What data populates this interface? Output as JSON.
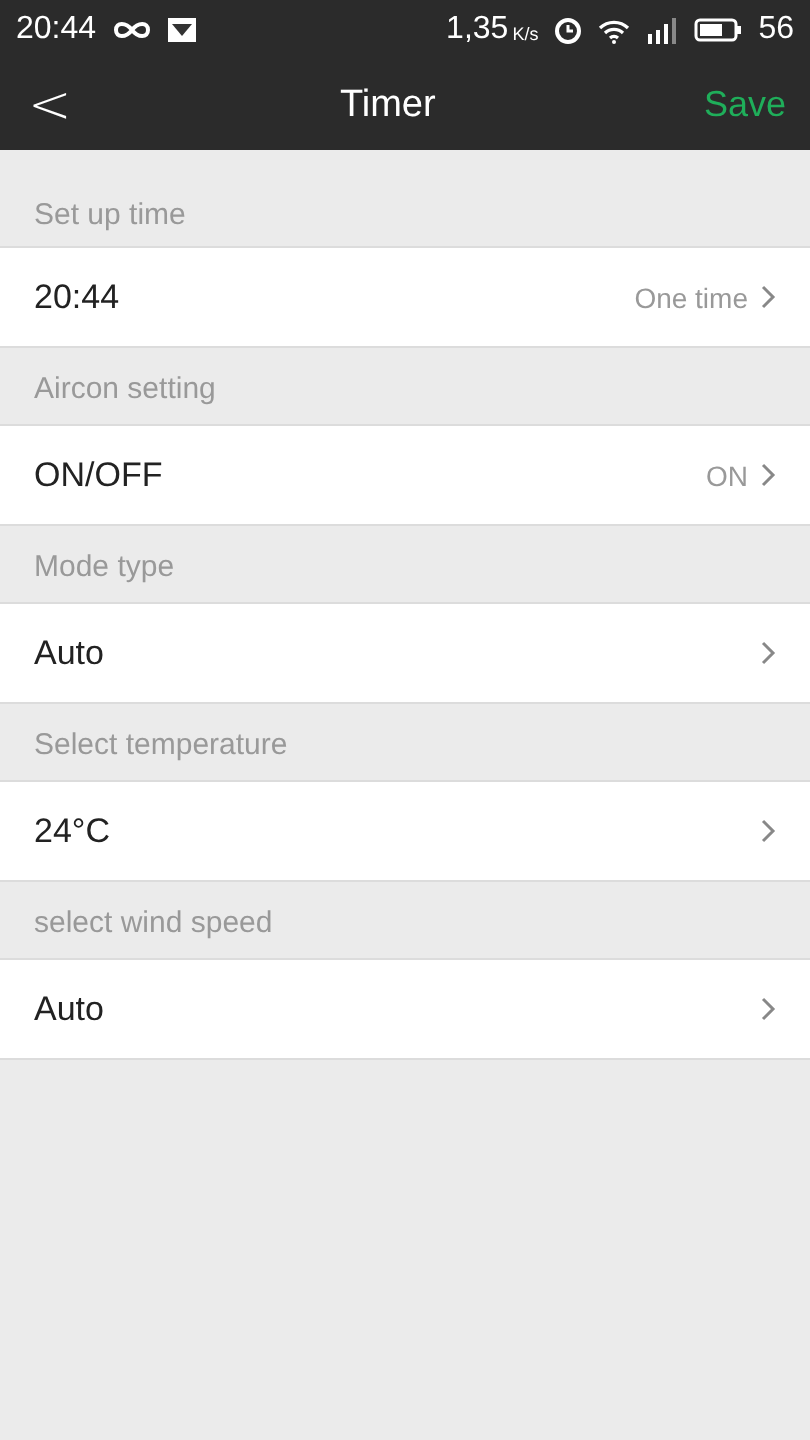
{
  "status_bar": {
    "time": "20:44",
    "speed": "1,35",
    "speed_unit": "K/s",
    "battery": "56"
  },
  "header": {
    "back": "<",
    "title": "Timer",
    "action": "Save"
  },
  "sections": [
    {
      "label": "Set up time",
      "value": "20:44",
      "detail": "One time"
    },
    {
      "label": "Aircon setting",
      "value": "ON/OFF",
      "detail": "ON"
    },
    {
      "label": "Mode type",
      "value": "Auto"
    },
    {
      "label": "Select temperature",
      "value": "24°C"
    },
    {
      "label": "select wind speed",
      "value": "Auto"
    }
  ]
}
